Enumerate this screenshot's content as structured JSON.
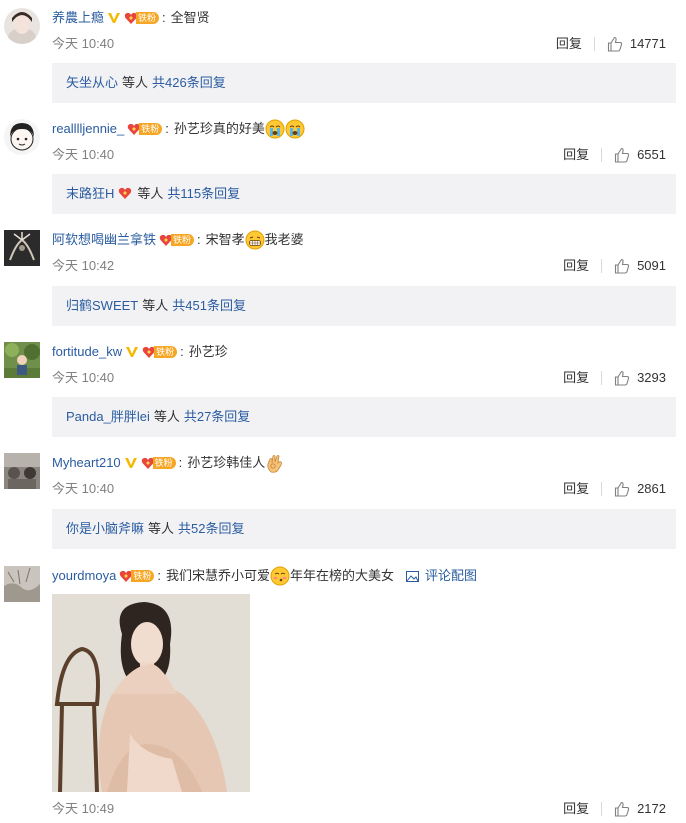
{
  "comments": [
    {
      "user": "养農上瘾",
      "verified": true,
      "fan_badge": "铁粉",
      "text": "全智贤",
      "time": "今天 10:40",
      "reply_label": "回复",
      "likes": "14771",
      "replies": {
        "user": "矢坐从心",
        "middle": "等人",
        "count_link": "共426条回复"
      }
    },
    {
      "user": "realllljennie_",
      "fan_badge": "铁粉",
      "text": "孙艺珍真的好美",
      "time": "今天 10:40",
      "reply_label": "回复",
      "likes": "6551",
      "replies": {
        "user": "末路狂H",
        "middle": "等人",
        "count_link": "共115条回复"
      }
    },
    {
      "user": "阿软想喝幽兰拿铁",
      "fan_badge": "铁粉",
      "text_before": "宋智孝",
      "text_after": "我老婆",
      "time": "今天 10:42",
      "reply_label": "回复",
      "likes": "5091",
      "replies": {
        "user": "归鹤SWEET",
        "middle": "等人",
        "count_link": "共451条回复"
      }
    },
    {
      "user": "fortitude_kw",
      "verified": true,
      "fan_badge": "铁粉",
      "text": "孙艺珍",
      "time": "今天 10:40",
      "reply_label": "回复",
      "likes": "3293",
      "replies": {
        "user": "Panda_胖胖lei",
        "middle": "等人",
        "count_link": "共27条回复"
      }
    },
    {
      "user": "Myheart210",
      "verified": true,
      "fan_badge": "铁粉",
      "text": "孙艺珍韩佳人",
      "time": "今天 10:40",
      "reply_label": "回复",
      "likes": "2861",
      "replies": {
        "user": "你是小脑斧嘛",
        "middle": "等人",
        "count_link": "共52条回复"
      }
    },
    {
      "user": "yourdmoya",
      "fan_badge": "铁粉",
      "text_before": "我们宋慧乔小可爱",
      "text_after": "年年在榜的大美女",
      "pic_link": "评论配图",
      "time": "今天 10:49",
      "reply_label": "回复",
      "likes": "2172"
    }
  ],
  "colors": {
    "link": "#2a5c9f",
    "time": "#808080",
    "reply_bg": "#f2f2f5",
    "badge_gold": "#f6a623",
    "verified": "#f5b800"
  }
}
